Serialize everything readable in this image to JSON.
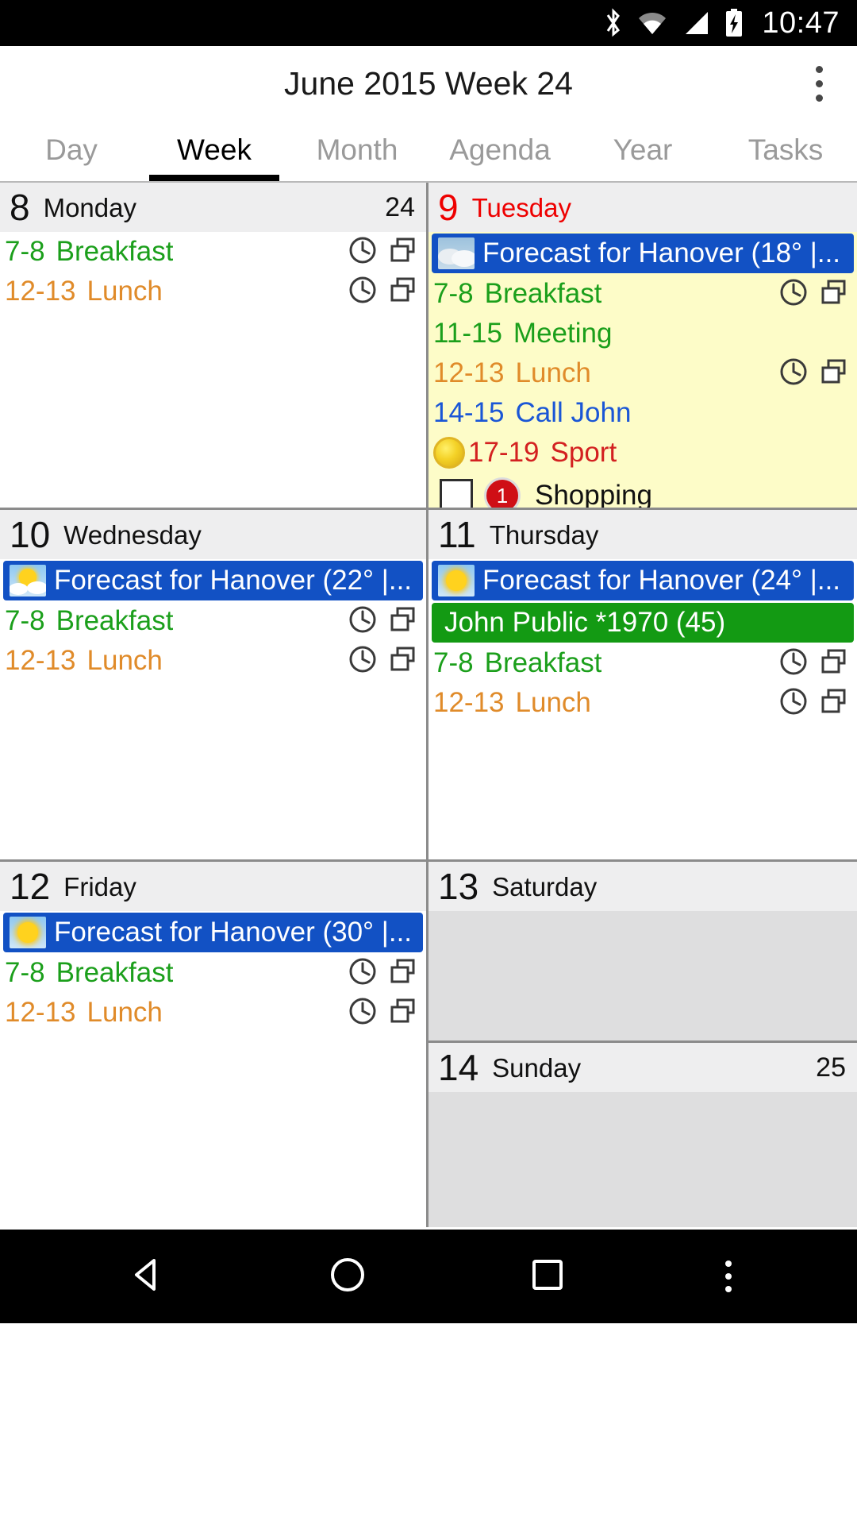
{
  "status_bar": {
    "time": "10:47",
    "icons": [
      "bluetooth-icon",
      "wifi-icon",
      "cellular-signal-icon",
      "battery-charging-icon"
    ]
  },
  "action_bar": {
    "title": "June 2015 Week 24",
    "overflow_label": "More options"
  },
  "tabs": [
    {
      "label": "Day",
      "active": false
    },
    {
      "label": "Week",
      "active": true
    },
    {
      "label": "Month",
      "active": false
    },
    {
      "label": "Agenda",
      "active": false
    },
    {
      "label": "Year",
      "active": false
    },
    {
      "label": "Tasks",
      "active": false
    }
  ],
  "colors": {
    "event_green": "#1b9f1b",
    "event_orange": "#e08b2a",
    "event_blue": "#1a56d6",
    "event_red": "#d32020",
    "banner_blue": "#1251c4",
    "banner_green": "#139a13",
    "today_bg": "#fdfcc8",
    "weekend_bg": "#dededf",
    "header_bg": "#eeeeef",
    "today_text": "#ee0000"
  },
  "days": [
    {
      "num": "8",
      "name": "Monday",
      "week_num": "24",
      "today": false,
      "weekend": false,
      "banners": [],
      "events": [
        {
          "time": "7-8",
          "title": "Breakfast",
          "color": "#1b9f1b",
          "icons": [
            "clock-icon",
            "repeat-icon"
          ]
        },
        {
          "time": "12-13",
          "title": "Lunch",
          "color": "#e08b2a",
          "icons": [
            "clock-icon",
            "repeat-icon"
          ]
        }
      ],
      "tasks": []
    },
    {
      "num": "9",
      "name": "Tuesday",
      "week_num": "",
      "today": true,
      "weekend": false,
      "banners": [
        {
          "text": "Forecast for Hanover (18° |...",
          "style": "blue",
          "icon": "weather-overcast-icon"
        }
      ],
      "events": [
        {
          "time": "7-8",
          "title": "Breakfast",
          "color": "#1b9f1b",
          "icons": [
            "clock-icon",
            "repeat-icon"
          ]
        },
        {
          "time": "11-15",
          "title": "Meeting",
          "color": "#1b9f1b",
          "icons": []
        },
        {
          "time": "12-13",
          "title": "Lunch",
          "color": "#e08b2a",
          "icons": [
            "clock-icon",
            "repeat-icon"
          ]
        },
        {
          "time": "14-15",
          "title": "Call John",
          "color": "#1a56d6",
          "icons": []
        },
        {
          "time": "17-19",
          "title": "Sport",
          "color": "#d32020",
          "icons": [],
          "lead_icon": "sport-ball-icon"
        }
      ],
      "tasks": [
        {
          "title": "Shopping",
          "badge": "1",
          "checked": false
        }
      ]
    },
    {
      "num": "10",
      "name": "Wednesday",
      "week_num": "",
      "today": false,
      "weekend": false,
      "banners": [
        {
          "text": "Forecast for Hanover (22° |...",
          "style": "blue",
          "icon": "weather-partly-sunny-icon"
        }
      ],
      "events": [
        {
          "time": "7-8",
          "title": "Breakfast",
          "color": "#1b9f1b",
          "icons": [
            "clock-icon",
            "repeat-icon"
          ]
        },
        {
          "time": "12-13",
          "title": "Lunch",
          "color": "#e08b2a",
          "icons": [
            "clock-icon",
            "repeat-icon"
          ]
        }
      ],
      "tasks": []
    },
    {
      "num": "11",
      "name": "Thursday",
      "week_num": "",
      "today": false,
      "weekend": false,
      "banners": [
        {
          "text": "Forecast for Hanover (24° |...",
          "style": "blue",
          "icon": "weather-sunny-icon"
        },
        {
          "text": "John Public *1970 (45)",
          "style": "green",
          "icon": null
        }
      ],
      "events": [
        {
          "time": "7-8",
          "title": "Breakfast",
          "color": "#1b9f1b",
          "icons": [
            "clock-icon",
            "repeat-icon"
          ]
        },
        {
          "time": "12-13",
          "title": "Lunch",
          "color": "#e08b2a",
          "icons": [
            "clock-icon",
            "repeat-icon"
          ]
        }
      ],
      "tasks": []
    },
    {
      "num": "12",
      "name": "Friday",
      "week_num": "",
      "today": false,
      "weekend": false,
      "banners": [
        {
          "text": "Forecast for Hanover (30° |...",
          "style": "blue",
          "icon": "weather-sunny-icon"
        }
      ],
      "events": [
        {
          "time": "7-8",
          "title": "Breakfast",
          "color": "#1b9f1b",
          "icons": [
            "clock-icon",
            "repeat-icon"
          ]
        },
        {
          "time": "12-13",
          "title": "Lunch",
          "color": "#e08b2a",
          "icons": [
            "clock-icon",
            "repeat-icon"
          ]
        }
      ],
      "tasks": []
    },
    {
      "num": "13",
      "name": "Saturday",
      "week_num": "",
      "today": false,
      "weekend": true,
      "banners": [],
      "events": [],
      "tasks": []
    },
    {
      "num": "14",
      "name": "Sunday",
      "week_num": "25",
      "today": false,
      "weekend": true,
      "banners": [],
      "events": [],
      "tasks": []
    }
  ],
  "nav_bar": {
    "items": [
      "back-triangle-icon",
      "home-circle-icon",
      "recents-square-icon",
      "menu-dots-icon"
    ]
  }
}
